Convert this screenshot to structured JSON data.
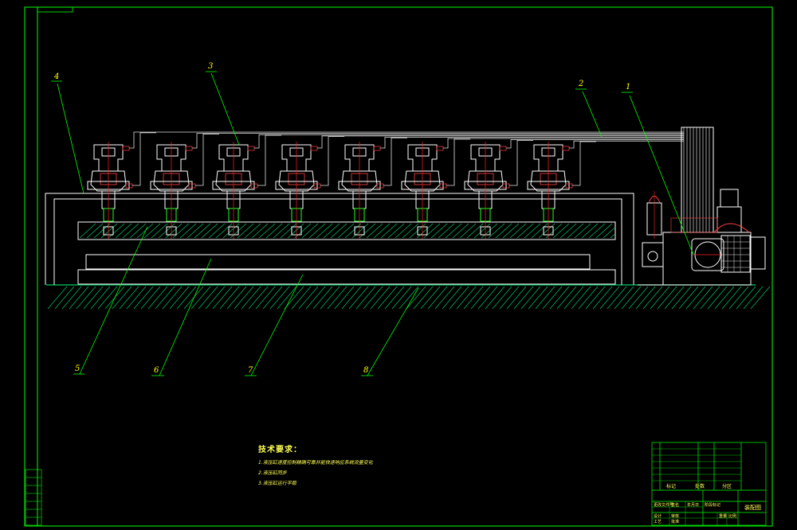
{
  "balloons": [
    "1",
    "2",
    "3",
    "4",
    "5",
    "6",
    "7",
    "8"
  ],
  "technical_notes": {
    "heading": "技术要求：",
    "lines": [
      "1.液压缸速度控制精确可靠并能快速响应系统流量变化",
      "2.液压缸同步",
      "3.液压缸运行平稳"
    ]
  },
  "title_block": {
    "drawing_name": "装配图",
    "labels": [
      "标记",
      "处数",
      "分区",
      "更改文件号",
      "签名",
      "年月日",
      "设计",
      "审核",
      "工艺",
      "批准",
      "阶段标记",
      "重量",
      "比例"
    ]
  },
  "colors": {
    "frame": "#00ff00",
    "outline": "#ffffff",
    "centerline": "#ff2020",
    "leader": "#00ff00",
    "text": "#ffff55",
    "hatch": "#00cc66",
    "hose": "#e0e0e0"
  }
}
